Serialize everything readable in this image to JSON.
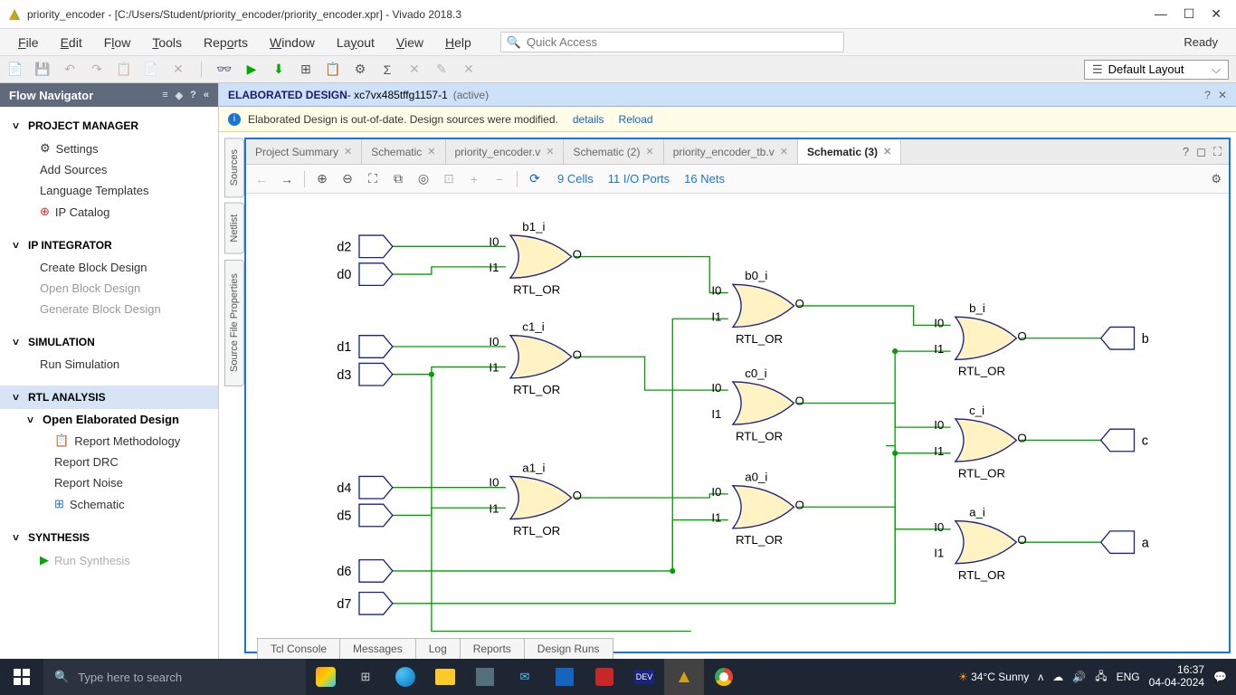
{
  "window": {
    "title": "priority_encoder - [C:/Users/Student/priority_encoder/priority_encoder.xpr] - Vivado 2018.3"
  },
  "menu": {
    "file": "File",
    "edit": "Edit",
    "flow": "Flow",
    "tools": "Tools",
    "reports": "Reports",
    "window": "Window",
    "layout": "Layout",
    "view": "View",
    "help": "Help",
    "search_placeholder": "Quick Access",
    "status_right": "Ready"
  },
  "layout_dropdown": "Default Layout",
  "flownav": {
    "title": "Flow Navigator",
    "project_manager": "PROJECT MANAGER",
    "settings": "Settings",
    "add_sources": "Add Sources",
    "language_templates": "Language Templates",
    "ip_catalog": "IP Catalog",
    "ip_integrator": "IP INTEGRATOR",
    "create_block": "Create Block Design",
    "open_block": "Open Block Design",
    "generate_block": "Generate Block Design",
    "simulation": "SIMULATION",
    "run_simulation": "Run Simulation",
    "rtl_analysis": "RTL ANALYSIS",
    "open_elaborated": "Open Elaborated Design",
    "report_methodology": "Report Methodology",
    "report_drc": "Report DRC",
    "report_noise": "Report Noise",
    "schematic": "Schematic",
    "synthesis": "SYNTHESIS",
    "run_synthesis": "Run Synthesis"
  },
  "design_header": {
    "label": "ELABORATED DESIGN",
    "part": " - xc7vx485tffg1157-1",
    "active": "(active)"
  },
  "banner": {
    "text": "Elaborated Design is out-of-date. Design sources were modified.",
    "details": "details",
    "reload": "Reload"
  },
  "vtabs": {
    "sources": "Sources",
    "netlist": "Netlist",
    "sfp": "Source File Properties"
  },
  "tabs": [
    {
      "label": "Project Summary"
    },
    {
      "label": "Schematic"
    },
    {
      "label": "priority_encoder.v"
    },
    {
      "label": "Schematic (2)"
    },
    {
      "label": "priority_encoder_tb.v"
    },
    {
      "label": "Schematic (3)"
    }
  ],
  "editor_info": {
    "cells": "9 Cells",
    "ports": "11 I/O Ports",
    "nets": "16 Nets"
  },
  "schematic": {
    "inputs": {
      "d2": "d2",
      "d0": "d0",
      "d1": "d1",
      "d3": "d3",
      "d4": "d4",
      "d5": "d5",
      "d6": "d6",
      "d7": "d7"
    },
    "outputs": {
      "b": "b",
      "c": "c",
      "a": "a"
    },
    "gate_pins": {
      "i0": "I0",
      "i1": "I1",
      "o": "O"
    },
    "gate_type": "RTL_OR",
    "gate_names": {
      "b1": "b1_i",
      "c1": "c1_i",
      "a1": "a1_i",
      "b0": "b0_i",
      "c0": "c0_i",
      "a0": "a0_i",
      "bi": "b_i",
      "ci": "c_i",
      "ai": "a_i"
    }
  },
  "bottom_tabs": {
    "tcl": "Tcl Console",
    "msg": "Messages",
    "log": "Log",
    "reports": "Reports",
    "runs": "Design Runs"
  },
  "taskbar": {
    "search_placeholder": "Type here to search",
    "weather": "34°C  Sunny",
    "lang": "ENG",
    "time": "16:37",
    "date": "04-04-2024"
  }
}
